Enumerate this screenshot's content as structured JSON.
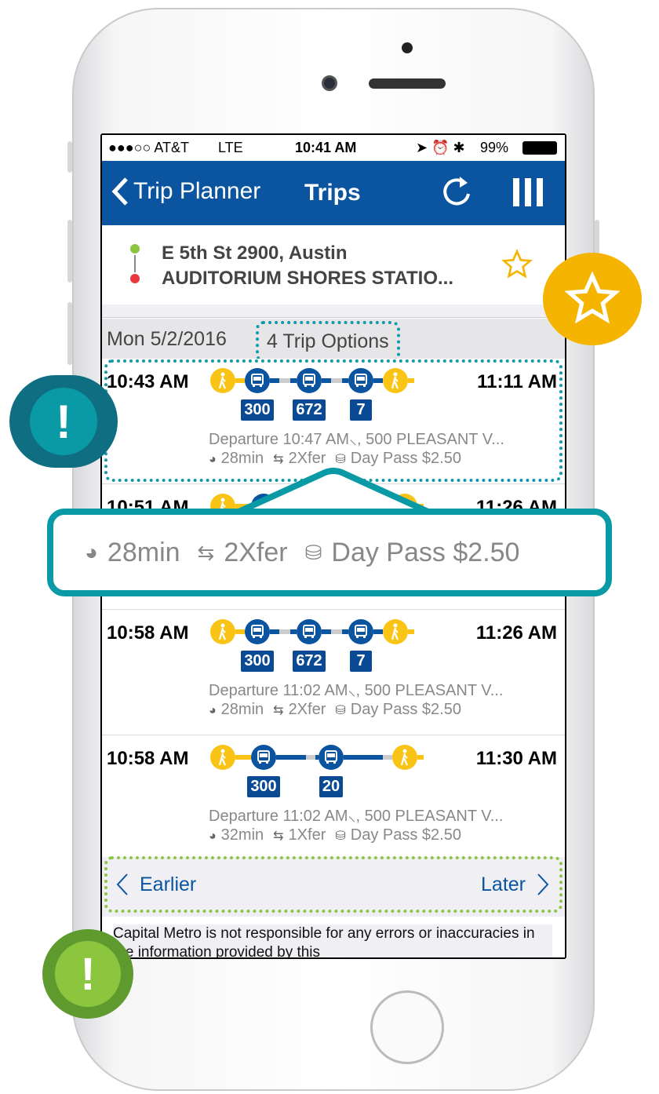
{
  "status": {
    "carrier": "●●●○○ AT&T",
    "network": "LTE",
    "time": "10:41 AM",
    "battery": "99%"
  },
  "nav": {
    "back_label": "Trip Planner",
    "title": "Trips",
    "refresh_icon": "refresh-icon",
    "menu_icon": "menu-icon",
    "color": "#0a54a0"
  },
  "addresses": {
    "origin": "E 5th St 2900, Austin",
    "destination": "AUDITORIUM SHORES STATIO...",
    "origin_color": "#8cc63f",
    "destination_color": "#e8383d"
  },
  "date": "Mon 5/2/2016",
  "trip_options": "4 Trip Options",
  "trips": [
    {
      "depart": "10:43 AM",
      "arrive": "11:11 AM",
      "routes": [
        "300",
        "672",
        "7"
      ],
      "departure": "Departure 10:47 AM",
      "stop": ", 500 PLEASANT V...",
      "duration": "28min",
      "transfers": "2Xfer",
      "fare": "Day Pass $2.50"
    },
    {
      "depart": "10:51 AM",
      "arrive": "11:26 AM"
    },
    {
      "depart": "10:58 AM",
      "arrive": "11:26 AM",
      "routes": [
        "300",
        "672",
        "7"
      ],
      "departure": "Departure 11:02 AM",
      "stop": ", 500 PLEASANT V...",
      "duration": "28min",
      "transfers": "2Xfer",
      "fare": "Day Pass $2.50"
    },
    {
      "depart": "10:58 AM",
      "arrive": "11:30 AM",
      "routes": [
        "300",
        "20"
      ],
      "departure": "Departure 11:02 AM",
      "stop": ", 500 PLEASANT V...",
      "duration": "32min",
      "transfers": "1Xfer",
      "fare": "Day Pass $2.50"
    }
  ],
  "pager": {
    "earlier": "Earlier",
    "later": "Later"
  },
  "disclaimer": "Capital Metro is not responsible for any errors or inaccuracies in the information provided by this",
  "callout": {
    "duration": "28min",
    "transfers": "2Xfer",
    "fare": "Day Pass $2.50",
    "color": "#0a9aa6"
  },
  "badges": {
    "alert": "!",
    "favorite_icon": "star-icon"
  }
}
